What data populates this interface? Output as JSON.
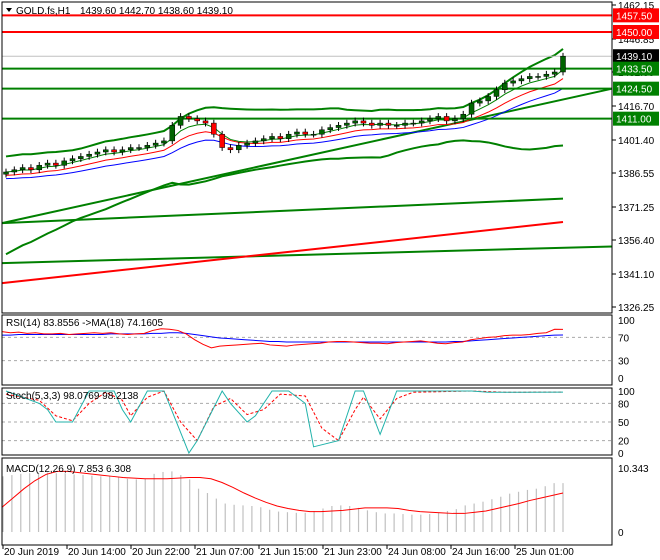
{
  "header": {
    "symbol": "GOLD.fs,H1",
    "ohlc": "1439.60 1442.70 1438.60 1439.10"
  },
  "colors": {
    "bull": "#006400",
    "bear": "#ff0000",
    "level_red": "#ff0000",
    "level_green": "#008000",
    "band": "#008000",
    "rsi": "#ff0000",
    "rsi_ma": "#0000ff",
    "stoch_k": "#20b2aa",
    "stoch_d": "#ff0000",
    "macd_hist": "#c0c0c0",
    "macd_signal": "#ff0000"
  },
  "price_axis": {
    "ticks": [
      "1462.15",
      "1446.85",
      "1432.00",
      "1416.70",
      "1401.40",
      "1386.55",
      "1371.25",
      "1356.40",
      "1341.10",
      "1326.25"
    ],
    "range": [
      1326.25,
      1462.15
    ]
  },
  "levels": [
    {
      "price": 1457.5,
      "label": "1457.50",
      "kind": "red"
    },
    {
      "price": 1450.0,
      "label": "1450.00",
      "kind": "red"
    },
    {
      "price": 1439.1,
      "label": "1439.10",
      "kind": "current"
    },
    {
      "price": 1433.5,
      "label": "1433.50",
      "kind": "green"
    },
    {
      "price": 1424.5,
      "label": "1424.50",
      "kind": "green"
    },
    {
      "price": 1411.0,
      "label": "1411.00",
      "kind": "green"
    }
  ],
  "chart_data": {
    "type": "candlestick",
    "title": "GOLD.fs,H1",
    "closes": [
      1387,
      1388,
      1389,
      1388,
      1390,
      1391,
      1390,
      1392,
      1393,
      1394,
      1395,
      1396,
      1397,
      1396,
      1397,
      1398,
      1398,
      1399,
      1400,
      1401,
      1408,
      1412,
      1411,
      1410,
      1409,
      1404,
      1398,
      1397,
      1399,
      1400,
      1401,
      1402,
      1403,
      1402,
      1404,
      1405,
      1404,
      1404,
      1406,
      1407,
      1408,
      1409,
      1410,
      1409,
      1408,
      1409,
      1408,
      1408,
      1409,
      1409,
      1410,
      1411,
      1412,
      1410,
      1411,
      1413,
      1418,
      1419,
      1421,
      1424,
      1427,
      1428,
      1429,
      1430,
      1430,
      1431,
      1432,
      1439.1
    ],
    "trendlines": [
      {
        "from": 1364,
        "to": 1424.5,
        "color": "green"
      },
      {
        "from": 1346,
        "to": 1353.5,
        "color": "green"
      },
      {
        "from": 1337,
        "to": 1364.5,
        "color": "red"
      },
      {
        "from": 1364,
        "to": 1375,
        "color": "green"
      }
    ]
  },
  "rsi": {
    "label": "RSI(14) 83.8556  ->MA(18) 74.1605",
    "ticks": [
      "100",
      "70",
      "30",
      "0"
    ],
    "values": [
      80,
      78,
      79,
      77,
      78,
      76,
      76,
      77,
      75,
      76,
      77,
      78,
      77,
      78,
      76,
      75,
      76,
      77,
      82,
      85,
      84,
      82,
      76,
      66,
      58,
      52,
      55,
      56,
      57,
      58,
      59,
      60,
      57,
      56,
      55,
      57,
      58,
      59,
      60,
      62,
      63,
      63,
      62,
      61,
      60,
      60,
      59,
      61,
      62,
      63,
      64,
      62,
      60,
      59,
      61,
      62,
      66,
      68,
      70,
      71,
      73,
      74,
      74,
      75,
      77,
      78,
      84,
      83.9
    ],
    "ma": [
      74,
      74,
      75,
      75,
      75,
      75,
      75,
      75,
      75,
      75,
      75,
      75,
      75,
      76,
      76,
      76,
      76,
      76,
      77,
      77,
      78,
      78,
      77,
      75,
      73,
      71,
      69,
      68,
      67,
      66,
      65,
      64,
      63,
      63,
      62,
      62,
      62,
      62,
      62,
      62,
      62,
      62,
      62,
      62,
      62,
      62,
      62,
      62,
      62,
      62,
      62,
      62,
      62,
      62,
      63,
      63,
      64,
      65,
      66,
      67,
      68,
      69,
      70,
      71,
      72,
      73,
      74,
      74.2
    ]
  },
  "stoch": {
    "label": "Stoch(5,3,3) 98.0769 98.2138",
    "ticks": [
      "100",
      "80",
      "50",
      "20",
      "0"
    ],
    "k": [
      [
        0,
        100
      ],
      [
        4,
        80
      ],
      [
        5,
        70
      ],
      [
        6,
        50
      ],
      [
        8,
        50
      ],
      [
        10,
        100
      ],
      [
        13,
        100
      ],
      [
        14,
        70
      ],
      [
        15,
        50
      ],
      [
        17,
        100
      ],
      [
        19,
        100
      ],
      [
        22,
        0
      ],
      [
        23,
        20
      ],
      [
        26,
        100
      ],
      [
        27,
        80
      ],
      [
        29,
        50
      ],
      [
        30,
        60
      ],
      [
        32,
        100
      ],
      [
        34,
        100
      ],
      [
        36,
        80
      ],
      [
        37,
        10
      ],
      [
        40,
        20
      ],
      [
        42,
        100
      ],
      [
        43,
        100
      ],
      [
        45,
        30
      ],
      [
        47,
        100
      ],
      [
        56,
        100
      ],
      [
        58,
        98
      ],
      [
        62,
        98
      ],
      [
        67,
        98.1
      ]
    ],
    "d": [
      [
        0,
        95
      ],
      [
        4,
        85
      ],
      [
        6,
        60
      ],
      [
        8,
        52
      ],
      [
        10,
        80
      ],
      [
        12,
        98
      ],
      [
        14,
        85
      ],
      [
        15,
        60
      ],
      [
        17,
        90
      ],
      [
        19,
        100
      ],
      [
        21,
        50
      ],
      [
        23,
        20
      ],
      [
        25,
        75
      ],
      [
        27,
        88
      ],
      [
        29,
        62
      ],
      [
        31,
        70
      ],
      [
        33,
        95
      ],
      [
        36,
        92
      ],
      [
        38,
        40
      ],
      [
        40,
        20
      ],
      [
        42,
        70
      ],
      [
        43,
        90
      ],
      [
        45,
        55
      ],
      [
        47,
        88
      ],
      [
        49,
        98
      ],
      [
        56,
        100
      ],
      [
        60,
        98
      ],
      [
        67,
        98.2
      ]
    ]
  },
  "macd": {
    "label": "MACD(12,26,9) 7.853 6.308",
    "ticks": [
      "10.343",
      "0"
    ],
    "range": [
      0,
      10.343
    ],
    "hist": [
      9.0,
      9.2,
      9.4,
      9.5,
      9.6,
      9.6,
      9.5,
      9.4,
      9.3,
      9.2,
      9.1,
      9.0,
      9.0,
      8.9,
      8.6,
      8.5,
      8.6,
      9.4,
      9.7,
      9.8,
      9.2,
      8.5,
      7.0,
      6.3,
      5.4,
      4.6,
      4.4,
      4.3,
      4.2,
      4.0,
      3.6,
      3.3,
      3.2,
      3.1,
      3.1,
      3.4,
      3.8,
      4.2,
      4.3,
      4.2,
      3.9,
      3.5,
      3.2,
      3.0,
      3.0,
      2.9,
      2.8,
      2.8,
      2.9,
      3.1,
      3.4,
      3.7,
      4.3,
      4.6,
      4.9,
      5.3,
      5.7,
      6.2,
      6.5,
      6.8,
      7.0,
      7.4,
      7.9,
      7.9
    ],
    "signal": [
      4.0,
      5.5,
      7.0,
      8.3,
      9.3,
      9.8,
      9.8,
      9.6,
      9.4,
      9.2,
      9.0,
      8.8,
      8.7,
      8.6,
      8.6,
      8.6,
      8.7,
      8.8,
      8.8,
      8.6,
      8.0,
      7.2,
      6.3,
      5.5,
      4.8,
      4.2,
      3.8,
      3.5,
      3.3,
      3.3,
      3.4,
      3.5,
      3.7,
      3.9,
      3.9,
      3.9,
      3.8,
      3.5,
      3.3,
      3.2,
      3.1,
      3.0,
      3.0,
      3.2,
      3.4,
      3.8,
      4.2,
      4.6,
      5.1,
      5.5,
      5.9,
      6.3
    ]
  },
  "time_axis": [
    "20 Jun 2019",
    "20 Jun 14:00",
    "20 Jun 22:00",
    "21 Jun 07:00",
    "21 Jun 15:00",
    "21 Jun 23:00",
    "24 Jun 08:00",
    "24 Jun 16:00",
    "25 Jun 01:00"
  ]
}
